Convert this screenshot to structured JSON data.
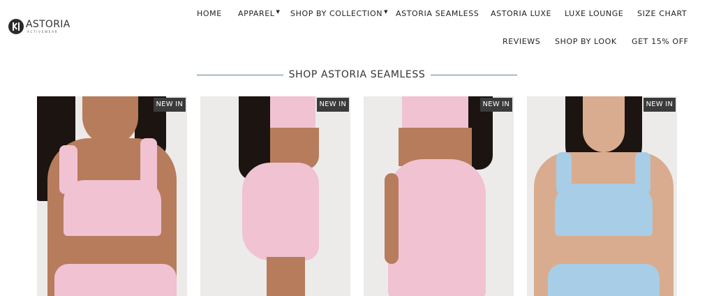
{
  "brand": {
    "name": "ASTORIA",
    "tagline": "ACTIVEWEAR"
  },
  "nav": {
    "row1": [
      {
        "label": "HOME",
        "dropdown": false
      },
      {
        "label": "APPAREL",
        "dropdown": true
      },
      {
        "label": "SHOP BY COLLECTION",
        "dropdown": true
      },
      {
        "label": "ASTORIA SEAMLESS",
        "dropdown": false
      },
      {
        "label": "ASTORIA LUXE",
        "dropdown": false
      },
      {
        "label": "LUXE LOUNGE",
        "dropdown": false
      },
      {
        "label": "SIZE CHART",
        "dropdown": false
      }
    ],
    "row2": [
      {
        "label": "REVIEWS"
      },
      {
        "label": "SHOP BY LOOK"
      },
      {
        "label": "GET 15% OFF"
      }
    ],
    "caret_glyph": "▼"
  },
  "section": {
    "title": "SHOP ASTORIA SEAMLESS"
  },
  "products": [
    {
      "badge": "NEW IN",
      "color": "#f0c2d2"
    },
    {
      "badge": "NEW IN",
      "color": "#f0c2d2"
    },
    {
      "badge": "NEW IN",
      "color": "#f0c2d2"
    },
    {
      "badge": "NEW IN",
      "color": "#a8cde6"
    }
  ],
  "colors": {
    "rule": "#5a7d96",
    "badge_bg": "#3b3b3b"
  }
}
